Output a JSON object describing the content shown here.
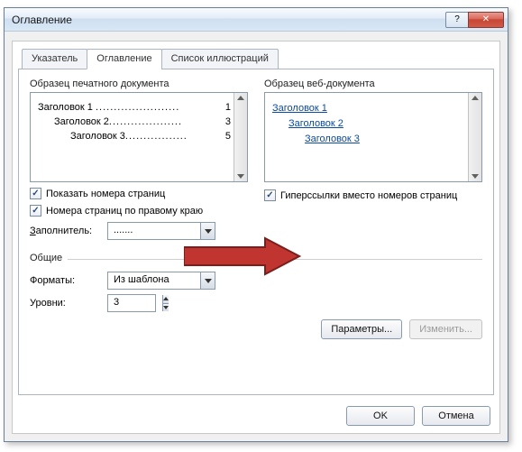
{
  "window": {
    "title": "Оглавление"
  },
  "tabs": {
    "items": [
      {
        "label": "Указатель"
      },
      {
        "label": "Оглавление"
      },
      {
        "label": "Список иллюстраций"
      }
    ]
  },
  "print_preview": {
    "label": "Образец печатного документа",
    "lines": [
      {
        "text": "Заголовок 1",
        "page": "1"
      },
      {
        "text": "Заголовок 2",
        "page": "3"
      },
      {
        "text": "Заголовок 3",
        "page": "5"
      }
    ]
  },
  "web_preview": {
    "label": "Образец веб-документа",
    "links": [
      {
        "text": "Заголовок 1"
      },
      {
        "text": "Заголовок 2"
      },
      {
        "text": "Заголовок 3"
      }
    ]
  },
  "options_left": {
    "show_numbers": {
      "label": "Показать номера страниц",
      "checked": true
    },
    "right_align": {
      "label": "Номера страниц по правому краю",
      "checked": true
    },
    "filler_label": "Заполнитель:",
    "filler_value": "......."
  },
  "options_right": {
    "hyperlinks": {
      "label": "Гиперссылки вместо номеров страниц",
      "checked": true
    }
  },
  "general": {
    "legend": "Общие",
    "format_label": "Форматы:",
    "format_value": "Из шаблона",
    "levels_label": "Уровни:",
    "levels_value": "3"
  },
  "buttons": {
    "params": "Параметры...",
    "modify": "Изменить...",
    "ok": "OK",
    "cancel": "Отмена"
  }
}
